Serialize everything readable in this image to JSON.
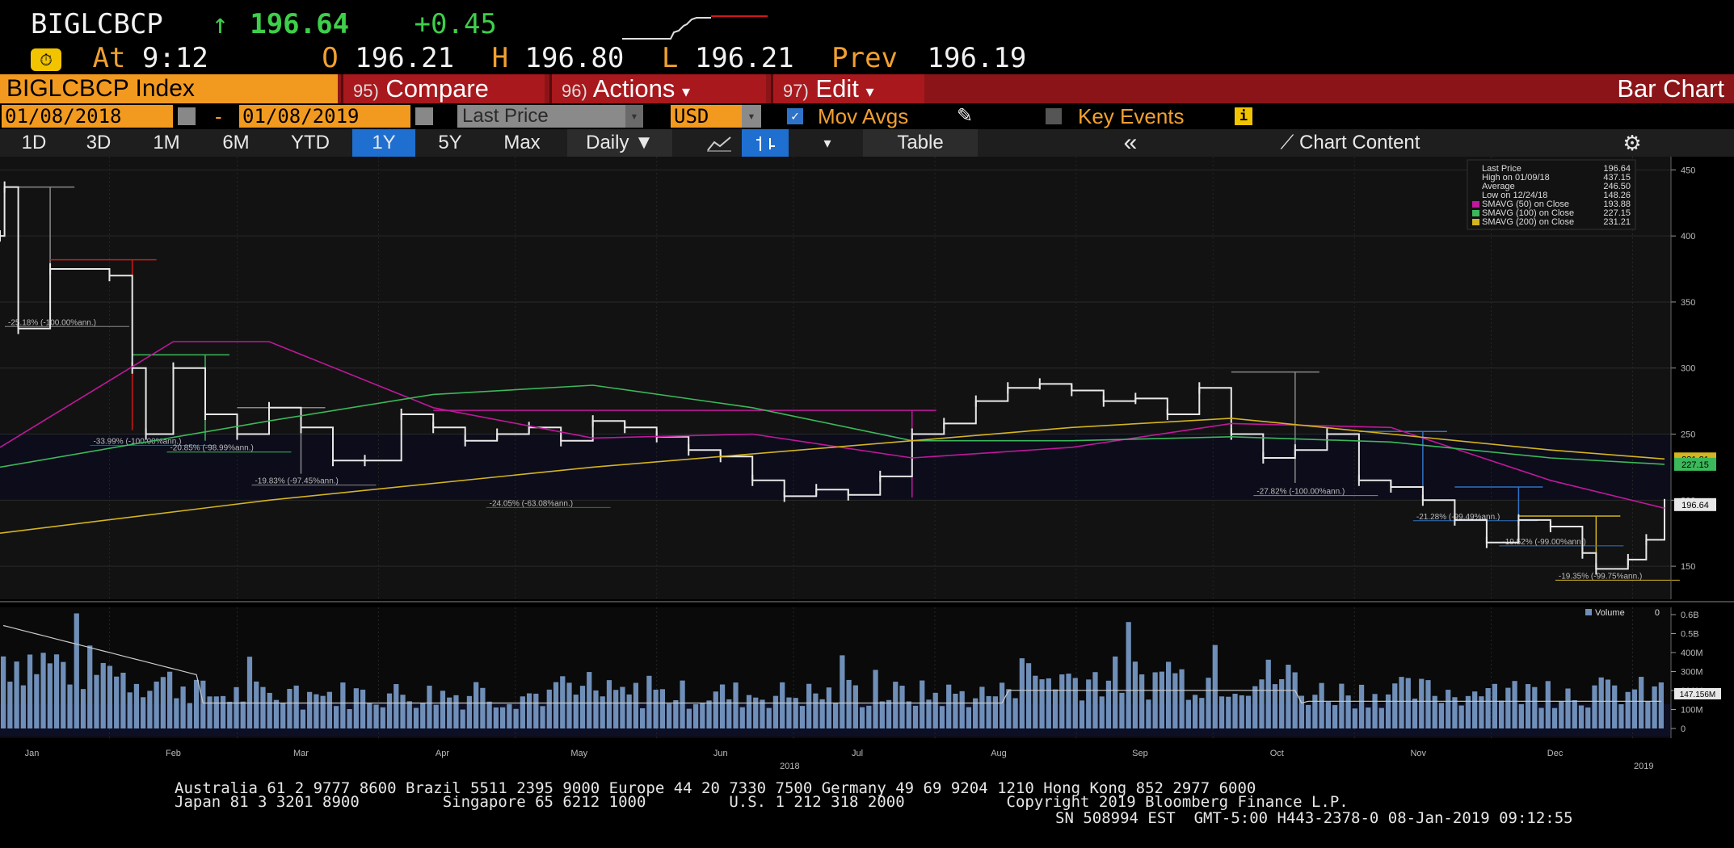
{
  "quote": {
    "ticker": "BIGLCBCP",
    "arrow": "↑",
    "last": "196.64",
    "change": "+0.45",
    "time_label": "At",
    "time": "9:12",
    "open_label": "O",
    "open": "196.21",
    "high_label": "H",
    "high": "196.80",
    "low_label": "L",
    "low": "196.21",
    "prev_label": "Prev",
    "prev": "196.19"
  },
  "menubar": {
    "index_name": "BIGLCBCP Index",
    "compare_num": "95)",
    "compare": "Compare",
    "actions_num": "96)",
    "actions": "Actions",
    "edit_num": "97)",
    "edit": "Edit",
    "title": "Bar Chart"
  },
  "range": {
    "start": "01/08/2018",
    "sep": "-",
    "end": "01/08/2019",
    "field": "Last Price",
    "currency": "USD",
    "mov_avgs": "Mov Avgs",
    "key_events": "Key Events"
  },
  "periods": [
    "1D",
    "3D",
    "1M",
    "6M",
    "YTD",
    "1Y",
    "5Y",
    "Max"
  ],
  "selected_period": "1Y",
  "toolbar": {
    "frequency": "Daily",
    "table": "Table",
    "collapse": "«",
    "chart_content": "Chart Content"
  },
  "legend": {
    "last_price": "Last Price",
    "last_price_val": "196.64",
    "high": "High on 01/09/18",
    "high_val": "437.15",
    "average": "Average",
    "average_val": "246.50",
    "low": "Low on 12/24/18",
    "low_val": "148.26",
    "sma50": "SMAVG (50)  on Close",
    "sma50_val": "193.88",
    "sma100": "SMAVG (100)  on Close",
    "sma100_val": "227.15",
    "sma200": "SMAVG (200)  on Close",
    "sma200_val": "231.21",
    "volume": "Volume",
    "volume_val": "0"
  },
  "chart_data": {
    "type": "line",
    "price_axis": {
      "ylim": [
        125,
        460
      ],
      "ticks": [
        150,
        200,
        250,
        300,
        350,
        400,
        450
      ]
    },
    "volume_axis": {
      "ticks": [
        "0",
        "100M",
        "200M",
        "300M",
        "400M",
        "0.5B",
        "0.6B"
      ],
      "current_label": "147.156M"
    },
    "x_months": [
      "Jan",
      "Feb",
      "Mar",
      "Apr",
      "May",
      "Jun",
      "Jul",
      "Aug",
      "Sep",
      "Oct",
      "Nov",
      "Dec"
    ],
    "x_year_labels": [
      "2018",
      "2019"
    ],
    "price_tags": [
      "196.64",
      "231.21",
      "227.15"
    ],
    "series": [
      {
        "name": "Last Price",
        "color": "#e8e8e8",
        "x": [
          "01/08/18",
          "01/09/18",
          "01/12/18",
          "01/19/18",
          "02/01/18",
          "02/06/18",
          "02/09/18",
          "02/15/18",
          "02/22/18",
          "03/01/18",
          "03/08/18",
          "03/15/18",
          "03/22/18",
          "03/29/18",
          "04/06/18",
          "04/13/18",
          "04/20/18",
          "04/27/18",
          "05/04/18",
          "05/11/18",
          "05/18/18",
          "05/25/18",
          "06/01/18",
          "06/08/18",
          "06/15/18",
          "06/22/18",
          "06/29/18",
          "07/06/18",
          "07/13/18",
          "07/20/18",
          "07/27/18",
          "08/03/18",
          "08/10/18",
          "08/17/18",
          "08/24/18",
          "08/31/18",
          "09/07/18",
          "09/14/18",
          "09/21/18",
          "09/28/18",
          "10/05/18",
          "10/12/18",
          "10/19/18",
          "10/26/18",
          "11/02/18",
          "11/09/18",
          "11/16/18",
          "11/23/18",
          "11/30/18",
          "12/07/18",
          "12/14/18",
          "12/21/18",
          "12/24/18",
          "12/31/18",
          "01/04/19",
          "01/08/19"
        ],
        "values": [
          400,
          437,
          330,
          375,
          370,
          300,
          250,
          300,
          265,
          250,
          270,
          255,
          230,
          230,
          265,
          255,
          245,
          250,
          255,
          245,
          260,
          255,
          248,
          238,
          233,
          215,
          203,
          208,
          204,
          218,
          250,
          258,
          275,
          285,
          288,
          283,
          275,
          277,
          265,
          285,
          250,
          232,
          238,
          250,
          215,
          210,
          200,
          185,
          168,
          185,
          180,
          160,
          148,
          155,
          170,
          196.64
        ]
      },
      {
        "name": "SMAVG (50)",
        "color": "#c0189c",
        "x": [
          "01/08/18",
          "02/15/18",
          "03/08/18",
          "04/13/18",
          "05/18/18",
          "06/22/18",
          "07/27/18",
          "08/31/18",
          "10/05/18",
          "11/09/18",
          "12/14/18",
          "01/08/19"
        ],
        "values": [
          240,
          320,
          320,
          270,
          247,
          250,
          232,
          240,
          258,
          255,
          215,
          193.88
        ]
      },
      {
        "name": "SMAVG (100)",
        "color": "#3cb85a",
        "x": [
          "01/08/18",
          "03/08/18",
          "04/13/18",
          "05/18/18",
          "06/22/18",
          "07/27/18",
          "08/31/18",
          "10/05/18",
          "11/09/18",
          "12/14/18",
          "01/08/19"
        ],
        "values": [
          225,
          260,
          280,
          287,
          270,
          245,
          245,
          248,
          244,
          232,
          227.15
        ]
      },
      {
        "name": "SMAVG (200)",
        "color": "#d4b420",
        "x": [
          "01/08/18",
          "03/08/18",
          "05/18/18",
          "07/27/18",
          "08/31/18",
          "10/05/18",
          "11/09/18",
          "12/14/18",
          "01/08/19"
        ],
        "values": [
          175,
          200,
          225,
          245,
          255,
          262,
          250,
          238,
          231.21
        ]
      }
    ],
    "annotations": [
      "-25.18% (-100.00%ann.)",
      "-33.99% (-100.00%ann.)",
      "-20.85% (-98.99%ann.)",
      "-19.83% (-97.45%ann.)",
      "-24.05% (-63.08%ann.)",
      "-27.82% (-100.00%ann.)",
      "-21.28% (-99.49%ann.)",
      "-19.52% (-99.00%ann.)",
      "-19.35% (-99.75%ann.)"
    ]
  },
  "footer": {
    "line1": "Australia 61 2 9777 8600 Brazil 5511 2395 9000 Europe 44 20 7330 7500 Germany 49 69 9204 1210 Hong Kong 852 2977 6000",
    "line2": "Japan 81 3 3201 8900         Singapore 65 6212 1000         U.S. 1 212 318 2000           Copyright 2019 Bloomberg Finance L.P.",
    "line3": "SN 508994 EST  GMT-5:00 H443-2378-0 08-Jan-2019 09:12:55"
  }
}
